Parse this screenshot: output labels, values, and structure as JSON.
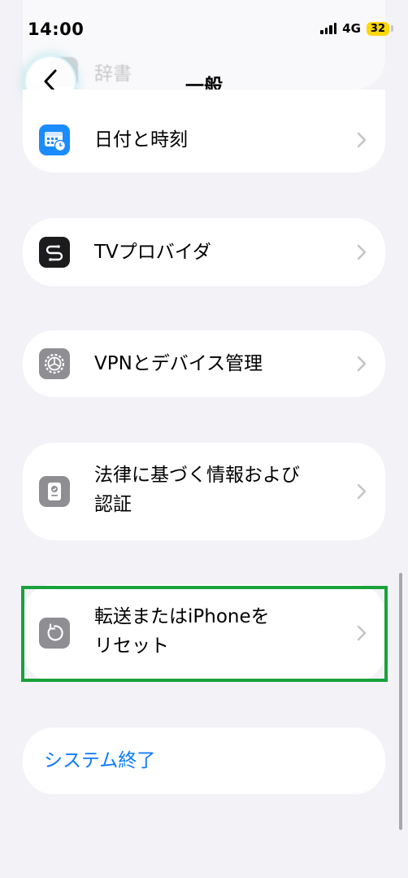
{
  "status_bar": {
    "time": "14:00",
    "network": "4G",
    "battery": "32"
  },
  "nav": {
    "title": "一般"
  },
  "ghost_rows": [
    {
      "label": "辞書"
    }
  ],
  "sections": [
    {
      "id": "datetime",
      "label_line1": "日付と時刻",
      "label_line2": "",
      "icon": "calendar-clock-icon",
      "icon_color": "#1b8cfe"
    },
    {
      "id": "tvprovider",
      "label_line1": "TVプロバイダ",
      "label_line2": "",
      "icon": "tv-provider-icon",
      "icon_color": "#1c1c1e"
    },
    {
      "id": "vpn",
      "label_line1": "VPNとデバイス管理",
      "label_line2": "",
      "icon": "gear-icon",
      "icon_color": "#8e8e93"
    },
    {
      "id": "legal",
      "label_line1": "法律に基づく情報および",
      "label_line2": "認証",
      "icon": "document-badge-icon",
      "icon_color": "#8e8e93"
    },
    {
      "id": "reset",
      "label_line1": "転送またはiPhoneを",
      "label_line2": "リセット",
      "icon": "reset-arrow-icon",
      "icon_color": "#8e8e93"
    }
  ],
  "shutdown": {
    "label": "システム終了",
    "color": "#0a7aff"
  }
}
